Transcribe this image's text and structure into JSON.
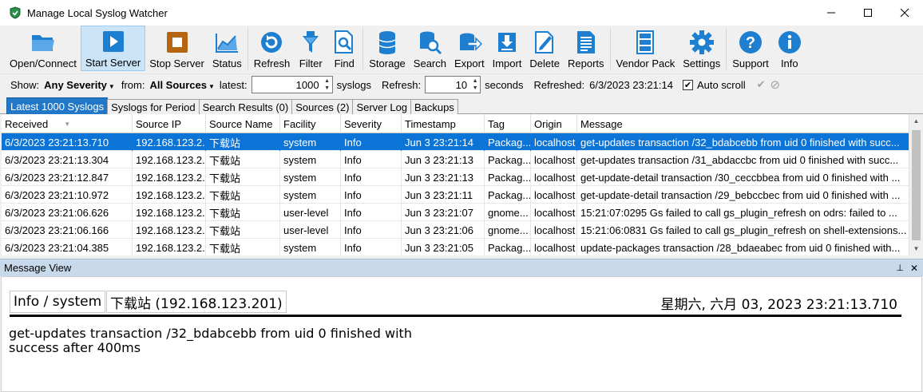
{
  "window": {
    "title": "Manage Local Syslog Watcher"
  },
  "toolbar": {
    "buttons": [
      {
        "label": "Open/Connect",
        "icon": "folder-icon",
        "color": "#1e7fd0"
      },
      {
        "label": "Start Server",
        "icon": "play-icon",
        "color": "#1e7fd0"
      },
      {
        "label": "Stop Server",
        "icon": "stop-icon",
        "color": "#c46a10"
      },
      {
        "label": "Status",
        "icon": "chart-icon",
        "color": "#1e7fd0"
      },
      {
        "label": "Refresh",
        "icon": "refresh-icon",
        "color": "#1e7fd0"
      },
      {
        "label": "Filter",
        "icon": "filter-icon",
        "color": "#1e7fd0"
      },
      {
        "label": "Find",
        "icon": "find-icon",
        "color": "#1e7fd0"
      },
      {
        "label": "Storage",
        "icon": "database-icon",
        "color": "#1e7fd0"
      },
      {
        "label": "Search",
        "icon": "database-search-icon",
        "color": "#1e7fd0"
      },
      {
        "label": "Export",
        "icon": "export-icon",
        "color": "#1e7fd0"
      },
      {
        "label": "Import",
        "icon": "import-icon",
        "color": "#1e7fd0"
      },
      {
        "label": "Delete",
        "icon": "delete-icon",
        "color": "#1e7fd0"
      },
      {
        "label": "Reports",
        "icon": "reports-icon",
        "color": "#1e7fd0"
      },
      {
        "label": "Vendor Pack",
        "icon": "vendor-pack-icon",
        "color": "#1e7fd0"
      },
      {
        "label": "Settings",
        "icon": "gear-icon",
        "color": "#1e7fd0"
      },
      {
        "label": "Support",
        "icon": "help-icon",
        "color": "#1e7fd0"
      },
      {
        "label": "Info",
        "icon": "info-icon",
        "color": "#1e7fd0"
      }
    ]
  },
  "filter": {
    "show_label": "Show:",
    "severity_value": "Any Severity",
    "from_label": "from:",
    "sources_value": "All Sources",
    "latest_label": "latest:",
    "latest_value": "1000",
    "syslogs_label": "syslogs",
    "refresh_label": "Refresh:",
    "refresh_value": "10",
    "seconds_label": "seconds",
    "refreshed_label": "Refreshed:",
    "refreshed_value": "6/3/2023 23:21:14",
    "autoscroll_label": "Auto scroll",
    "autoscroll_checked": true
  },
  "tabs": [
    {
      "label": "Latest 1000 Syslogs",
      "active": true
    },
    {
      "label": "Syslogs for Period",
      "active": false
    },
    {
      "label": "Search Results (0)",
      "active": false
    },
    {
      "label": "Sources (2)",
      "active": false
    },
    {
      "label": "Server Log",
      "active": false
    },
    {
      "label": "Backups",
      "active": false
    }
  ],
  "grid": {
    "columns": [
      "Received",
      "Source IP",
      "Source Name",
      "Facility",
      "Severity",
      "Timestamp",
      "Tag",
      "Origin",
      "Message"
    ],
    "rows": [
      {
        "received": "6/3/2023 23:21:13.710",
        "ip": "192.168.123.2...",
        "name": "下载站",
        "facility": "system",
        "severity": "Info",
        "timestamp": "Jun  3 23:21:14",
        "tag": "Packag...",
        "origin": "localhost",
        "message": "get-updates transaction /32_bdabcebb from uid 0 finished with succ..."
      },
      {
        "received": "6/3/2023 23:21:13.304",
        "ip": "192.168.123.2...",
        "name": "下载站",
        "facility": "system",
        "severity": "Info",
        "timestamp": "Jun  3 23:21:13",
        "tag": "Packag...",
        "origin": "localhost",
        "message": "get-updates transaction /31_abdaccbc from uid 0 finished with succ..."
      },
      {
        "received": "6/3/2023 23:21:12.847",
        "ip": "192.168.123.2...",
        "name": "下载站",
        "facility": "system",
        "severity": "Info",
        "timestamp": "Jun  3 23:21:13",
        "tag": "Packag...",
        "origin": "localhost",
        "message": "get-update-detail transaction /30_ceccbbea from uid 0 finished with ..."
      },
      {
        "received": "6/3/2023 23:21:10.972",
        "ip": "192.168.123.2...",
        "name": "下载站",
        "facility": "system",
        "severity": "Info",
        "timestamp": "Jun  3 23:21:11",
        "tag": "Packag...",
        "origin": "localhost",
        "message": "get-update-detail transaction /29_bebccbec from uid 0 finished with ..."
      },
      {
        "received": "6/3/2023 23:21:06.626",
        "ip": "192.168.123.2...",
        "name": "下载站",
        "facility": "user-level",
        "severity": "Info",
        "timestamp": "Jun  3 23:21:07",
        "tag": "gnome...",
        "origin": "localhost",
        "message": "15:21:07:0295 Gs  failed to call gs_plugin_refresh on odrs: failed to ..."
      },
      {
        "received": "6/3/2023 23:21:06.166",
        "ip": "192.168.123.2...",
        "name": "下载站",
        "facility": "user-level",
        "severity": "Info",
        "timestamp": "Jun  3 23:21:06",
        "tag": "gnome...",
        "origin": "localhost",
        "message": "15:21:06:0831 Gs  failed to call gs_plugin_refresh on shell-extensions..."
      },
      {
        "received": "6/3/2023 23:21:04.385",
        "ip": "192.168.123.2...",
        "name": "下载站",
        "facility": "system",
        "severity": "Info",
        "timestamp": "Jun  3 23:21:05",
        "tag": "Packag...",
        "origin": "localhost",
        "message": "update-packages transaction /28_bdaeabec from uid 0 finished with..."
      }
    ]
  },
  "message_view": {
    "title": "Message View",
    "severity_facility": "Info / system",
    "source": "下载站 (192.168.123.201)",
    "datetime": "星期六, 六月 03, 2023 23:21:13.710",
    "message": "get-updates transaction /32_bdabcebb from uid 0 finished with success after 400ms"
  }
}
